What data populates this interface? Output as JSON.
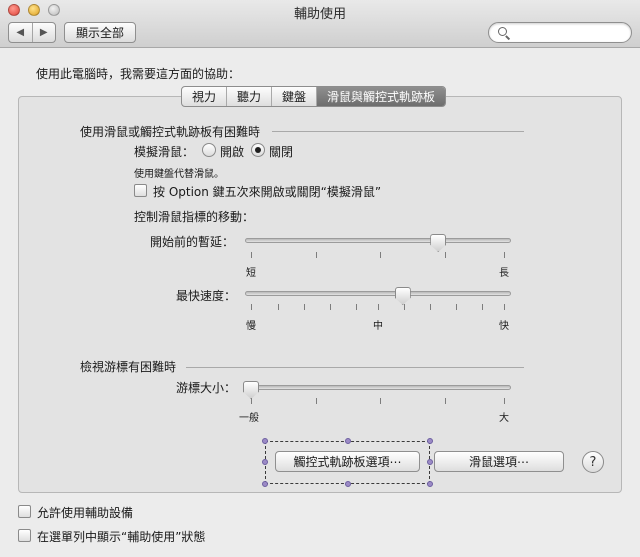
{
  "window": {
    "title": "輔助使用",
    "show_all": "顯示全部",
    "search_placeholder": ""
  },
  "intro": "使用此電腦時，我需要這方面的協助：",
  "tabs": [
    {
      "label": "視力",
      "active": false
    },
    {
      "label": "聽力",
      "active": false
    },
    {
      "label": "鍵盤",
      "active": false
    },
    {
      "label": "滑鼠與觸控式軌跡板",
      "active": true
    }
  ],
  "mouse_section": {
    "title": "使用滑鼠或觸控式軌跡板有困難時",
    "mouse_keys_label": "模擬滑鼠：",
    "option_on": "開啟",
    "option_off": "關閉",
    "selected": "關閉",
    "hint": "使用鍵盤代替滑鼠。",
    "option_key_checkbox": "按 Option 鍵五次來開啟或關閉“模擬滑鼠”",
    "option_key_checked": false,
    "pointer_title": "控制滑鼠指標的移動：",
    "initial_delay": {
      "label": "開始前的暫延：",
      "min_label": "短",
      "max_label": "長",
      "value": 0.74
    },
    "max_speed": {
      "label": "最快速度：",
      "min_label": "慢",
      "mid_label": "中",
      "max_label": "快",
      "value": 0.6
    }
  },
  "cursor_section": {
    "title": "檢視游標有困難時",
    "cursor_size_label": "游標大小：",
    "min_label": "一般",
    "max_label": "大",
    "value": 0.0
  },
  "buttons": {
    "trackpad_options": "觸控式軌跡板選項⋯",
    "mouse_options": "滑鼠選項⋯",
    "help": "?"
  },
  "footer": {
    "enable_access": "允許使用輔助設備",
    "enable_access_checked": false,
    "show_in_menu": "在選單列中顯示“輔助使用”狀態",
    "show_in_menu_checked": false
  }
}
